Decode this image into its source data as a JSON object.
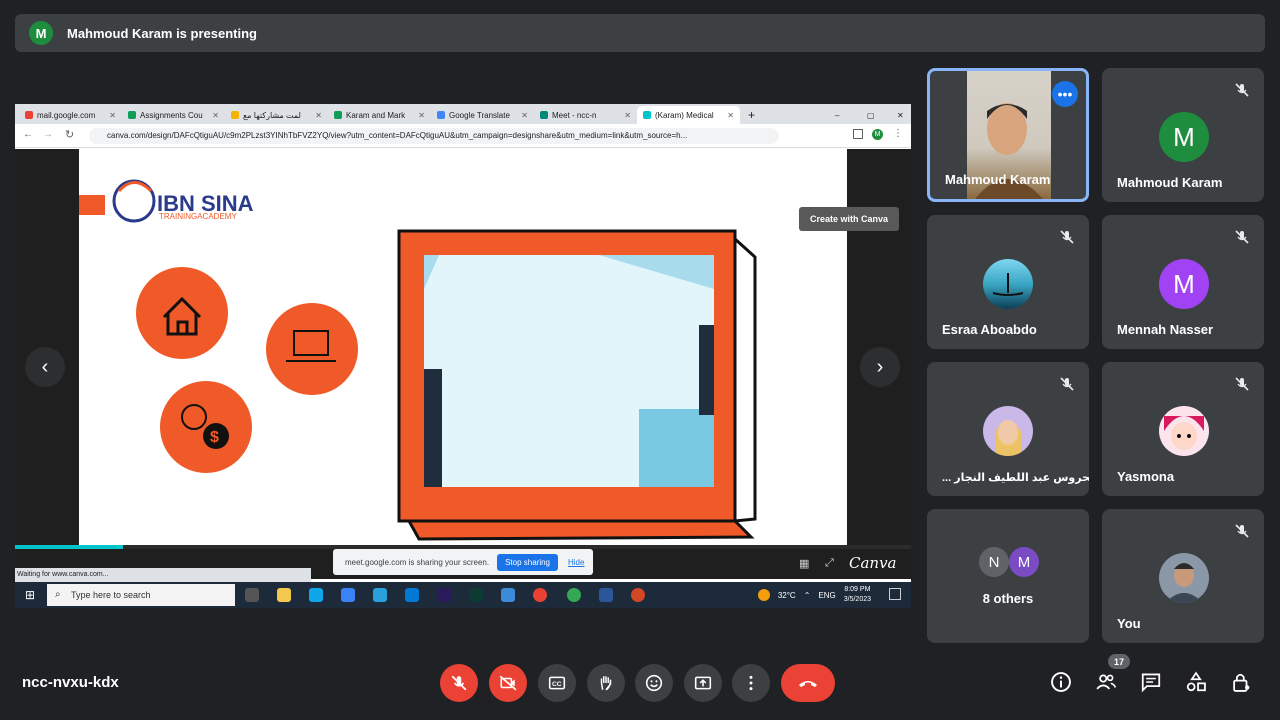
{
  "banner": {
    "avatar_letter": "M",
    "text": "Mahmoud Karam is presenting"
  },
  "browser": {
    "tabs": [
      {
        "label": "mail.google.com",
        "color": "#ea4335"
      },
      {
        "label": "Assignments Cou",
        "color": "#0f9d58"
      },
      {
        "label": "لمت مشاركتها مع",
        "color": "#f4b400"
      },
      {
        "label": "Karam and Mark",
        "color": "#0f9d58"
      },
      {
        "label": "Google Translate",
        "color": "#4285f4"
      },
      {
        "label": "Meet - ncc-n",
        "color": "#00897b"
      },
      {
        "label": "(Karam) Medical",
        "color": "#00c4cc"
      }
    ],
    "url": "canva.com/design/DAFcQtiguAU/c9m2PLzst3YINhTbFVZ2YQ/view?utm_content=DAFcQtiguAU&utm_campaign=designshare&utm_medium=link&utm_source=h...",
    "create_with_canva": "Create with Canva",
    "share_notice": "meet.google.com is sharing your screen.",
    "stop_sharing": "Stop sharing",
    "hide": "Hide",
    "canva_logo": "Canva",
    "status": "Waiting for www.canva.com...",
    "slide_progress": 0.12,
    "slide": {
      "logo_title": "IBN SINA",
      "logo_subtitle": "TRAININGACADEMY",
      "accent_color": "#f05a28"
    }
  },
  "taskbar": {
    "search_placeholder": "Type here to search",
    "temperature": "32°C",
    "language": "ENG",
    "time": "8:09 PM",
    "date": "3/5/2023"
  },
  "participants": [
    {
      "name": "Mahmoud Karam",
      "video": true
    },
    {
      "name": "Mahmoud Karam",
      "letter": "M",
      "color": "#1e8e3e"
    },
    {
      "name": "Esraa Aboabdo",
      "color": "#3aa6c4"
    },
    {
      "name": "Mennah Nasser",
      "letter": "M",
      "color": "#a142f4"
    },
    {
      "name": "... محروس عبد اللطيف النجار",
      "color": "#c9b8e8"
    },
    {
      "name": "Yasmona",
      "color": "#d81b60"
    },
    {
      "name": "8 others",
      "letters": [
        "N",
        "M"
      ]
    },
    {
      "name": "You",
      "color": "#6b7a8a"
    }
  ],
  "meeting_code": "ncc-nvxu-kdx",
  "people_count": "17"
}
